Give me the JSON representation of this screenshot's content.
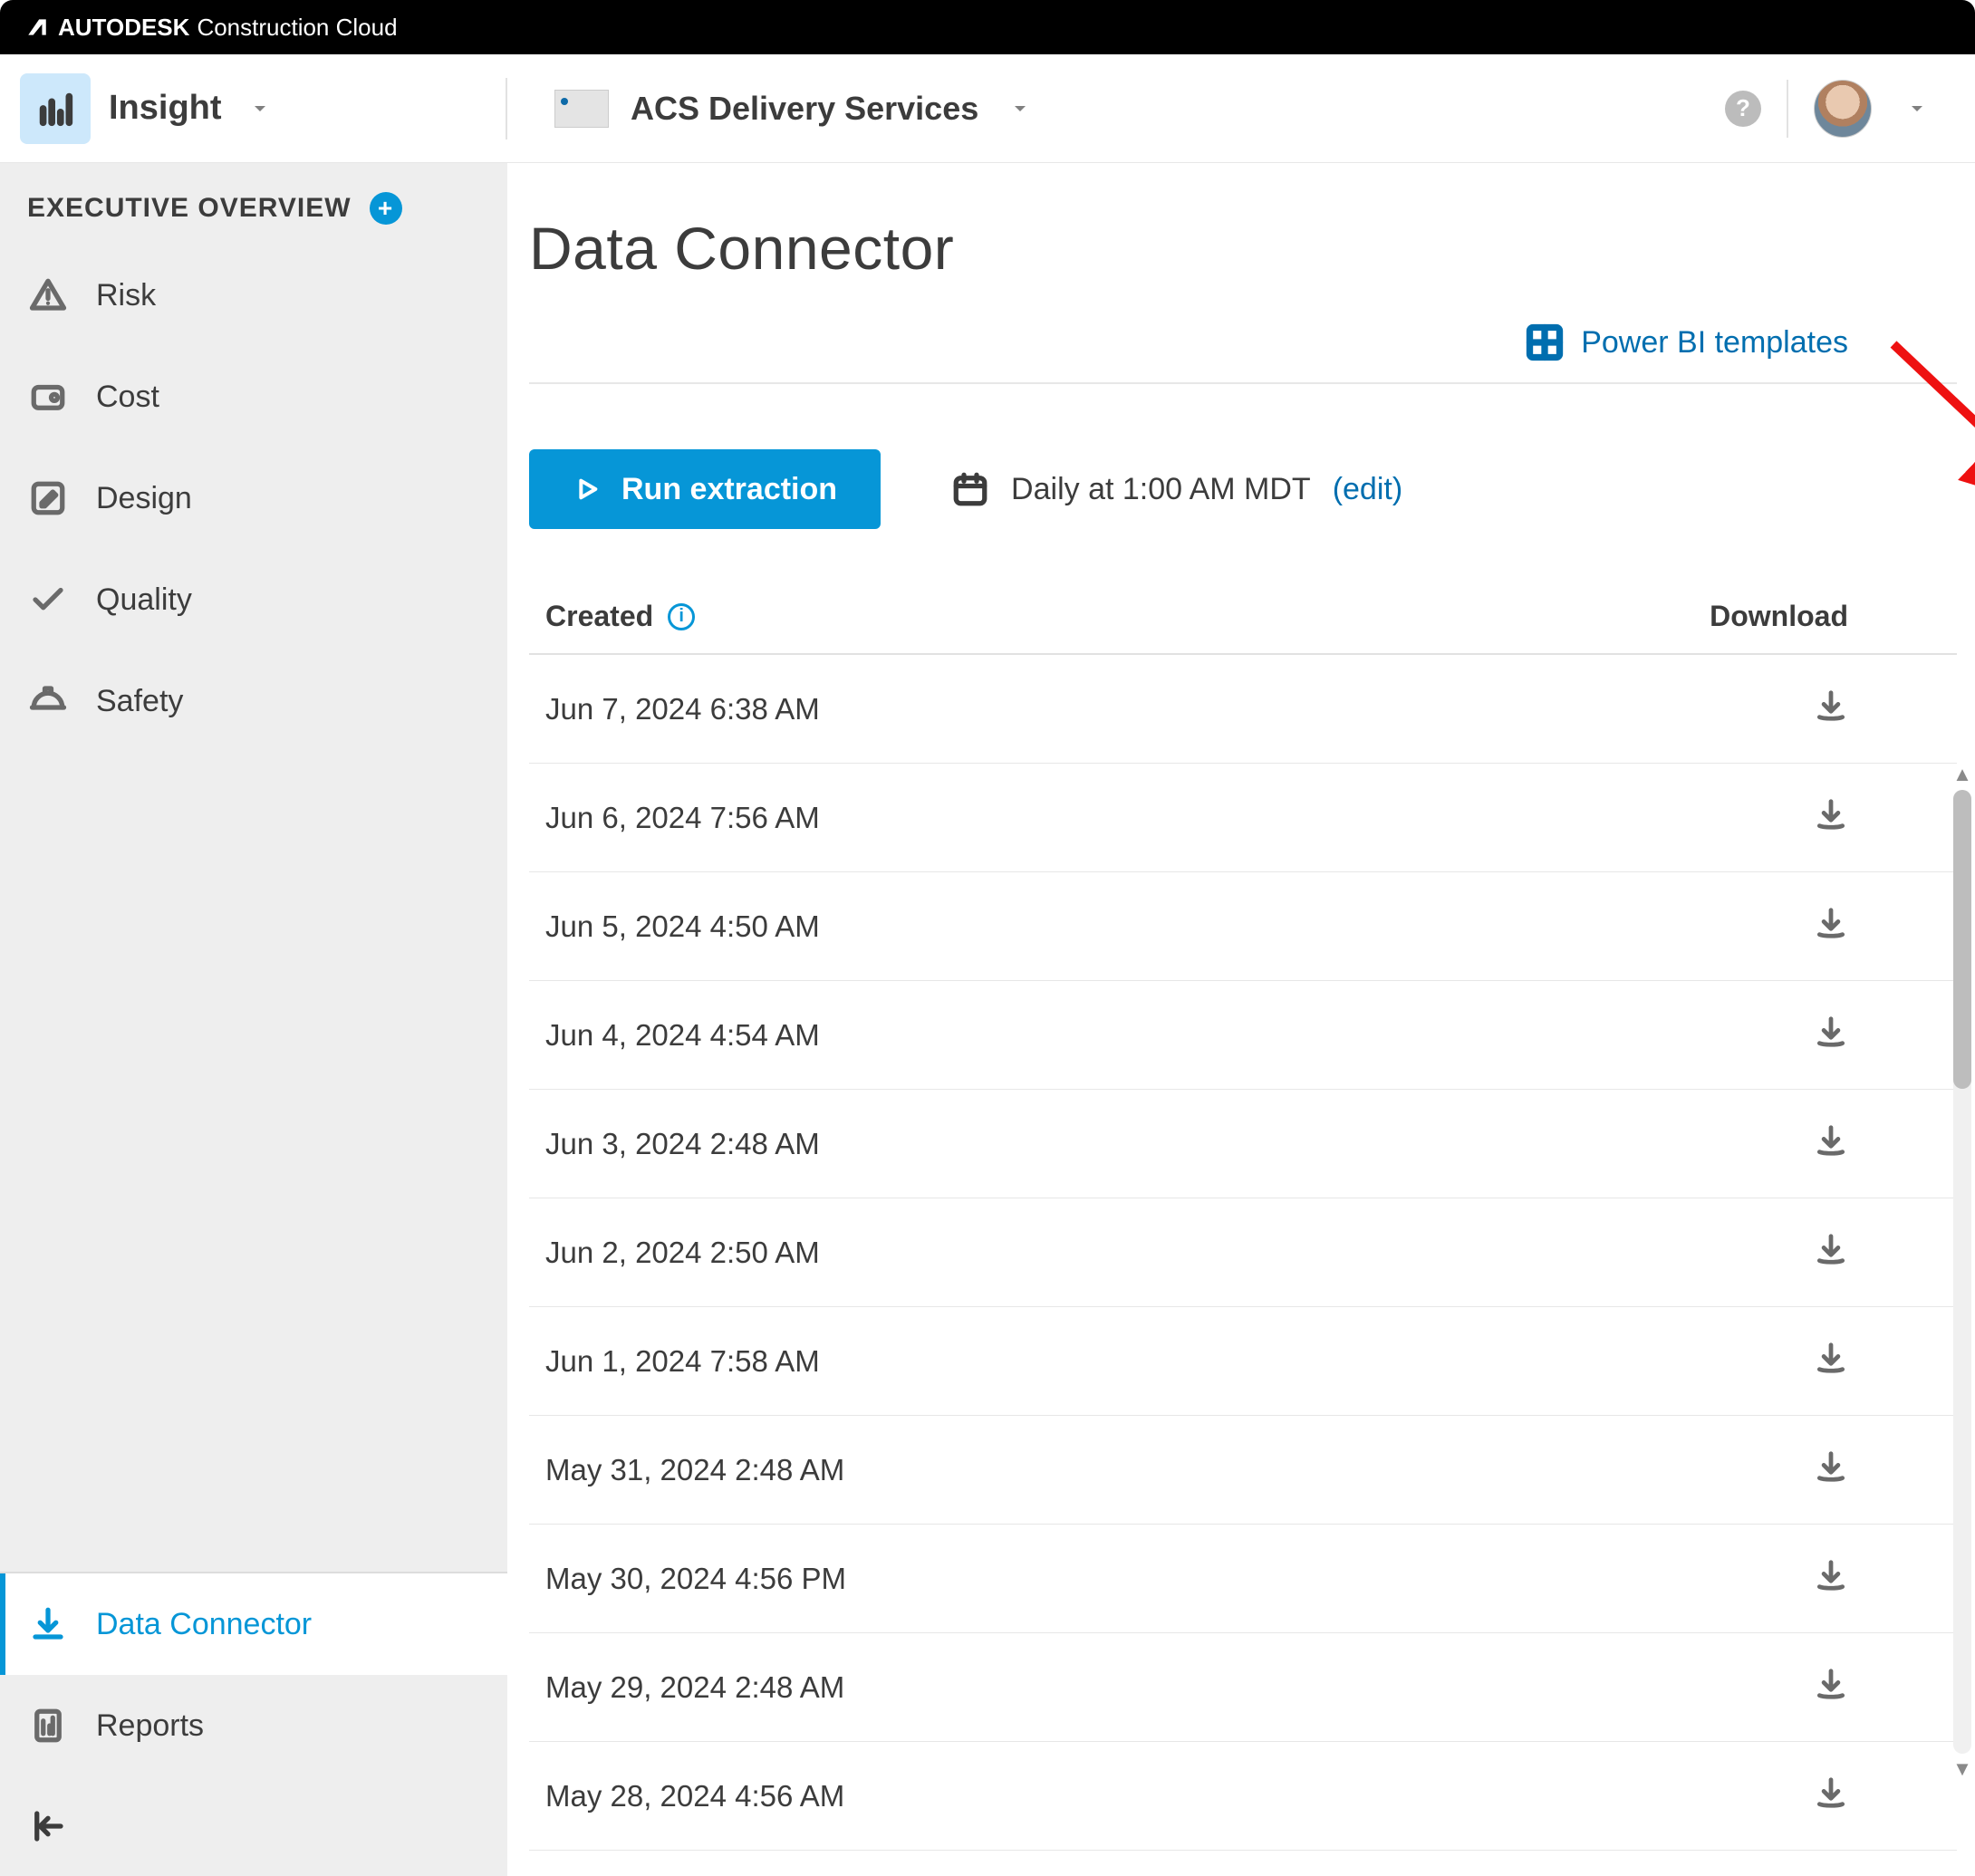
{
  "brand": {
    "vendor": "AUTODESK",
    "product": "Construction Cloud"
  },
  "header": {
    "module": "Insight",
    "account": "ACS Delivery Services"
  },
  "sidebar": {
    "section_title": "EXECUTIVE OVERVIEW",
    "items": [
      {
        "label": "Risk"
      },
      {
        "label": "Cost"
      },
      {
        "label": "Design"
      },
      {
        "label": "Quality"
      },
      {
        "label": "Safety"
      }
    ],
    "bottom": [
      {
        "label": "Data Connector",
        "active": true
      },
      {
        "label": "Reports",
        "active": false
      }
    ]
  },
  "page": {
    "title": "Data Connector",
    "power_bi_link": "Power BI templates",
    "run_button": "Run extraction",
    "schedule_text": "Daily at 1:00 AM MDT",
    "schedule_edit": "(edit)"
  },
  "table": {
    "col_created": "Created",
    "col_download": "Download",
    "rows": [
      {
        "created": "Jun 7, 2024 6:38 AM"
      },
      {
        "created": "Jun 6, 2024 7:56 AM"
      },
      {
        "created": "Jun 5, 2024 4:50 AM"
      },
      {
        "created": "Jun 4, 2024 4:54 AM"
      },
      {
        "created": "Jun 3, 2024 2:48 AM"
      },
      {
        "created": "Jun 2, 2024 2:50 AM"
      },
      {
        "created": "Jun 1, 2024 7:58 AM"
      },
      {
        "created": "May 31, 2024 2:48 AM"
      },
      {
        "created": "May 30, 2024 4:56 PM"
      },
      {
        "created": "May 29, 2024 2:48 AM"
      },
      {
        "created": "May 28, 2024 4:56 AM"
      }
    ]
  },
  "colors": {
    "primary": "#0696d7",
    "link": "#006eaf",
    "sidebar_bg": "#eeeeee"
  }
}
